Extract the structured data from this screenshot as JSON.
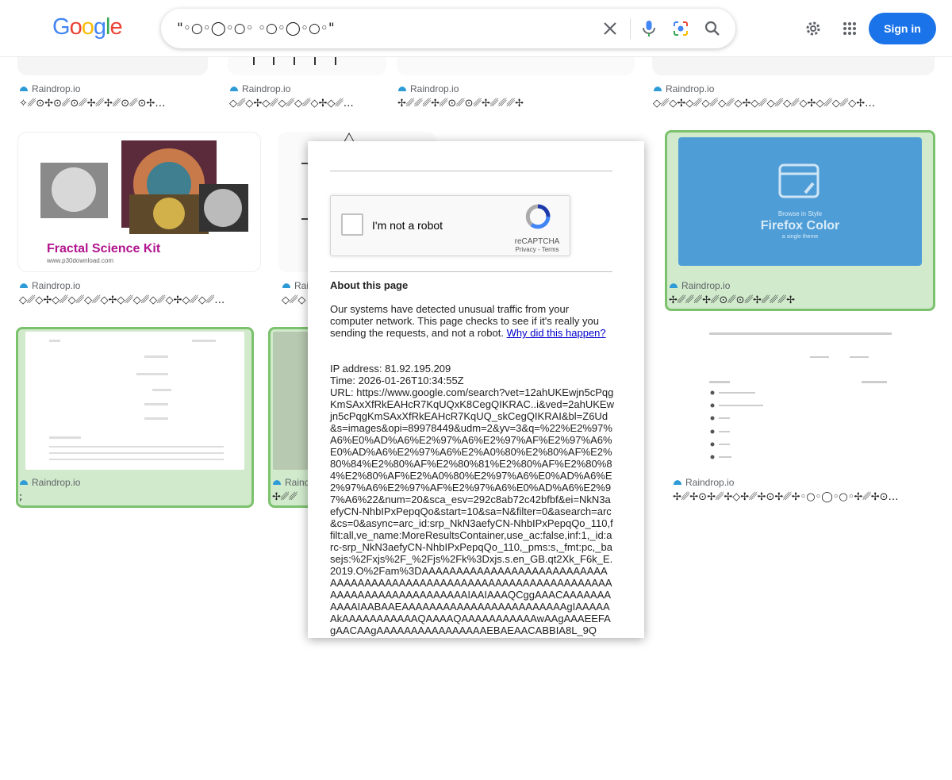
{
  "header": {
    "logo": [
      "G",
      "o",
      "o",
      "g",
      "l",
      "e"
    ],
    "logo_colors": [
      "#4285F4",
      "#EA4335",
      "#FBBC05",
      "#4285F4",
      "#34A853",
      "#EA4335"
    ],
    "query": "\"◦○◦◯◦○◦     ◦○◦◯◦○◦\"",
    "icons": {
      "clear": "close-icon",
      "voice": "microphone-icon",
      "lens": "camera-lens-icon",
      "search": "search-icon",
      "settings": "gear-icon",
      "apps": "apps-grid-icon"
    },
    "signin": "Sign in",
    "accent": "#1a73e8"
  },
  "results": [
    {
      "source": "Raindrop.io",
      "title": "✧␥⊙✢⊙␥⊙␥✢␥✢␥⊙␥⊙✢…"
    },
    {
      "source": "Raindrop.io",
      "title": "◇␥◇✢◇␥◇␥◇␥◇✢◇␥…"
    },
    {
      "source": "Raindrop.io",
      "title": "✢␥␥␥✢␥⊙␥⊙␥✢␥␥␥✢"
    },
    {
      "source": "Raindrop.io",
      "title": "◇␥◇✢◇␥◇␥◇␥◇✢◇␥◇␥◇␥◇✢◇␥◇␥◇✢…"
    },
    {
      "source": "Raindrop.io",
      "title": "◇␥◇✢◇␥◇␥◇␥◇✢◇␥◇␥◇␥◇✢◇␥◇␥…",
      "thumb_caption": "Fractal Science Kit",
      "thumb_sub": "www.p30download.com"
    },
    {
      "source": "Raindrop.io",
      "title": "◇␥◇"
    },
    {
      "source": "Raindrop.io",
      "title": "✢␥␥␥✢␥⊙␥⊙␥✢␥␥␥✢",
      "thumb_caption": "Firefox Color",
      "thumb_pre": "Browse in Style",
      "thumb_sub": "a single theme"
    },
    {
      "source": "Raindrop.io",
      "title": ";"
    },
    {
      "source": "Raindrop.io",
      "title": "✢␥␥"
    },
    {
      "source": "Raindrop.io",
      "title": "✢␥✢⊙✢␥✢◇✢␥✢⊙✢␥✢◦○◦◯◦○◦✢␥✢⊙…"
    }
  ],
  "dialog": {
    "checkbox_label": "I'm not a robot",
    "brand": "reCAPTCHA",
    "privacy": "Privacy",
    "sep": " - ",
    "terms": "Terms",
    "heading": "About this page",
    "body": "Our systems have detected unusual traffic from your computer network. This page checks to see if it's really you sending the requests, and not a robot. ",
    "why_link": "Why did this happen?",
    "ip": "IP address: 81.92.195.209",
    "time": "Time: 2026-01-26T10:34:55Z",
    "url": "URL: https://www.google.com/search?vet=12ahUKEwjn5cPqgKmSAxXfRkEAHcR7KqUQxK8CegQIKRAC..i&ved=2ahUKEwjn5cPqgKmSAxXfRkEAHcR7KqUQ_skCegQIKRAI&bl=Z6Ud&s=images&opi=89978449&udm=2&yv=3&q=%22%E2%97%A6%E0%AD%A6%E2%97%A6%E2%97%AF%E2%97%A6%E0%AD%A6%E2%97%A6%E2%A0%80%E2%80%AF%E2%80%84%E2%80%AF%E2%80%81%E2%80%AF%E2%80%84%E2%80%AF%E2%A0%80%E2%97%A6%E0%AD%A6%E2%97%A6%E2%97%AF%E2%97%A6%E0%AD%A6%E2%97%A6%22&num=20&sca_esv=292c8ab72c42bfbf&ei=NkN3aefyCN-NhbIPxPepqQo&start=10&sa=N&filter=0&asearch=arc&cs=0&async=arc_id:srp_NkN3aefyCN-NhbIPxPepqQo_110,ffilt:all,ve_name:MoreResultsContainer,use_ac:false,inf:1,_id:arc-srp_NkN3aefyCN-NhbIPxPepqQo_110,_pms:s,_fmt:pc,_basejs:%2Fxjs%2F_%2Fjs%2Fk%3Dxjs.s.en_GB.qt2Xk_F6k_E.2019.O%2Fam%3DAAAAAAAAAAAAAAAAAAAAAAAAAAAAAAAAAAAAAAAAAAAAAAAAAAAAAAAAAAAAAAAAAAAAAAAAAAAAAAAAAAAAAAAAIAAIAAAQCggAAACAAAAAAAAAAAIAABAAEAAAAAAAAAAAAAAAAAAAAAAAAgIAAAAAAkAAAAAAAAAAAQAAAAQAAAAAAAAAAAwAAgAAAEEFAgAACAAgAAAAAAAAAAAAAAAAEBAEAACABBIA8L_9Q"
  }
}
